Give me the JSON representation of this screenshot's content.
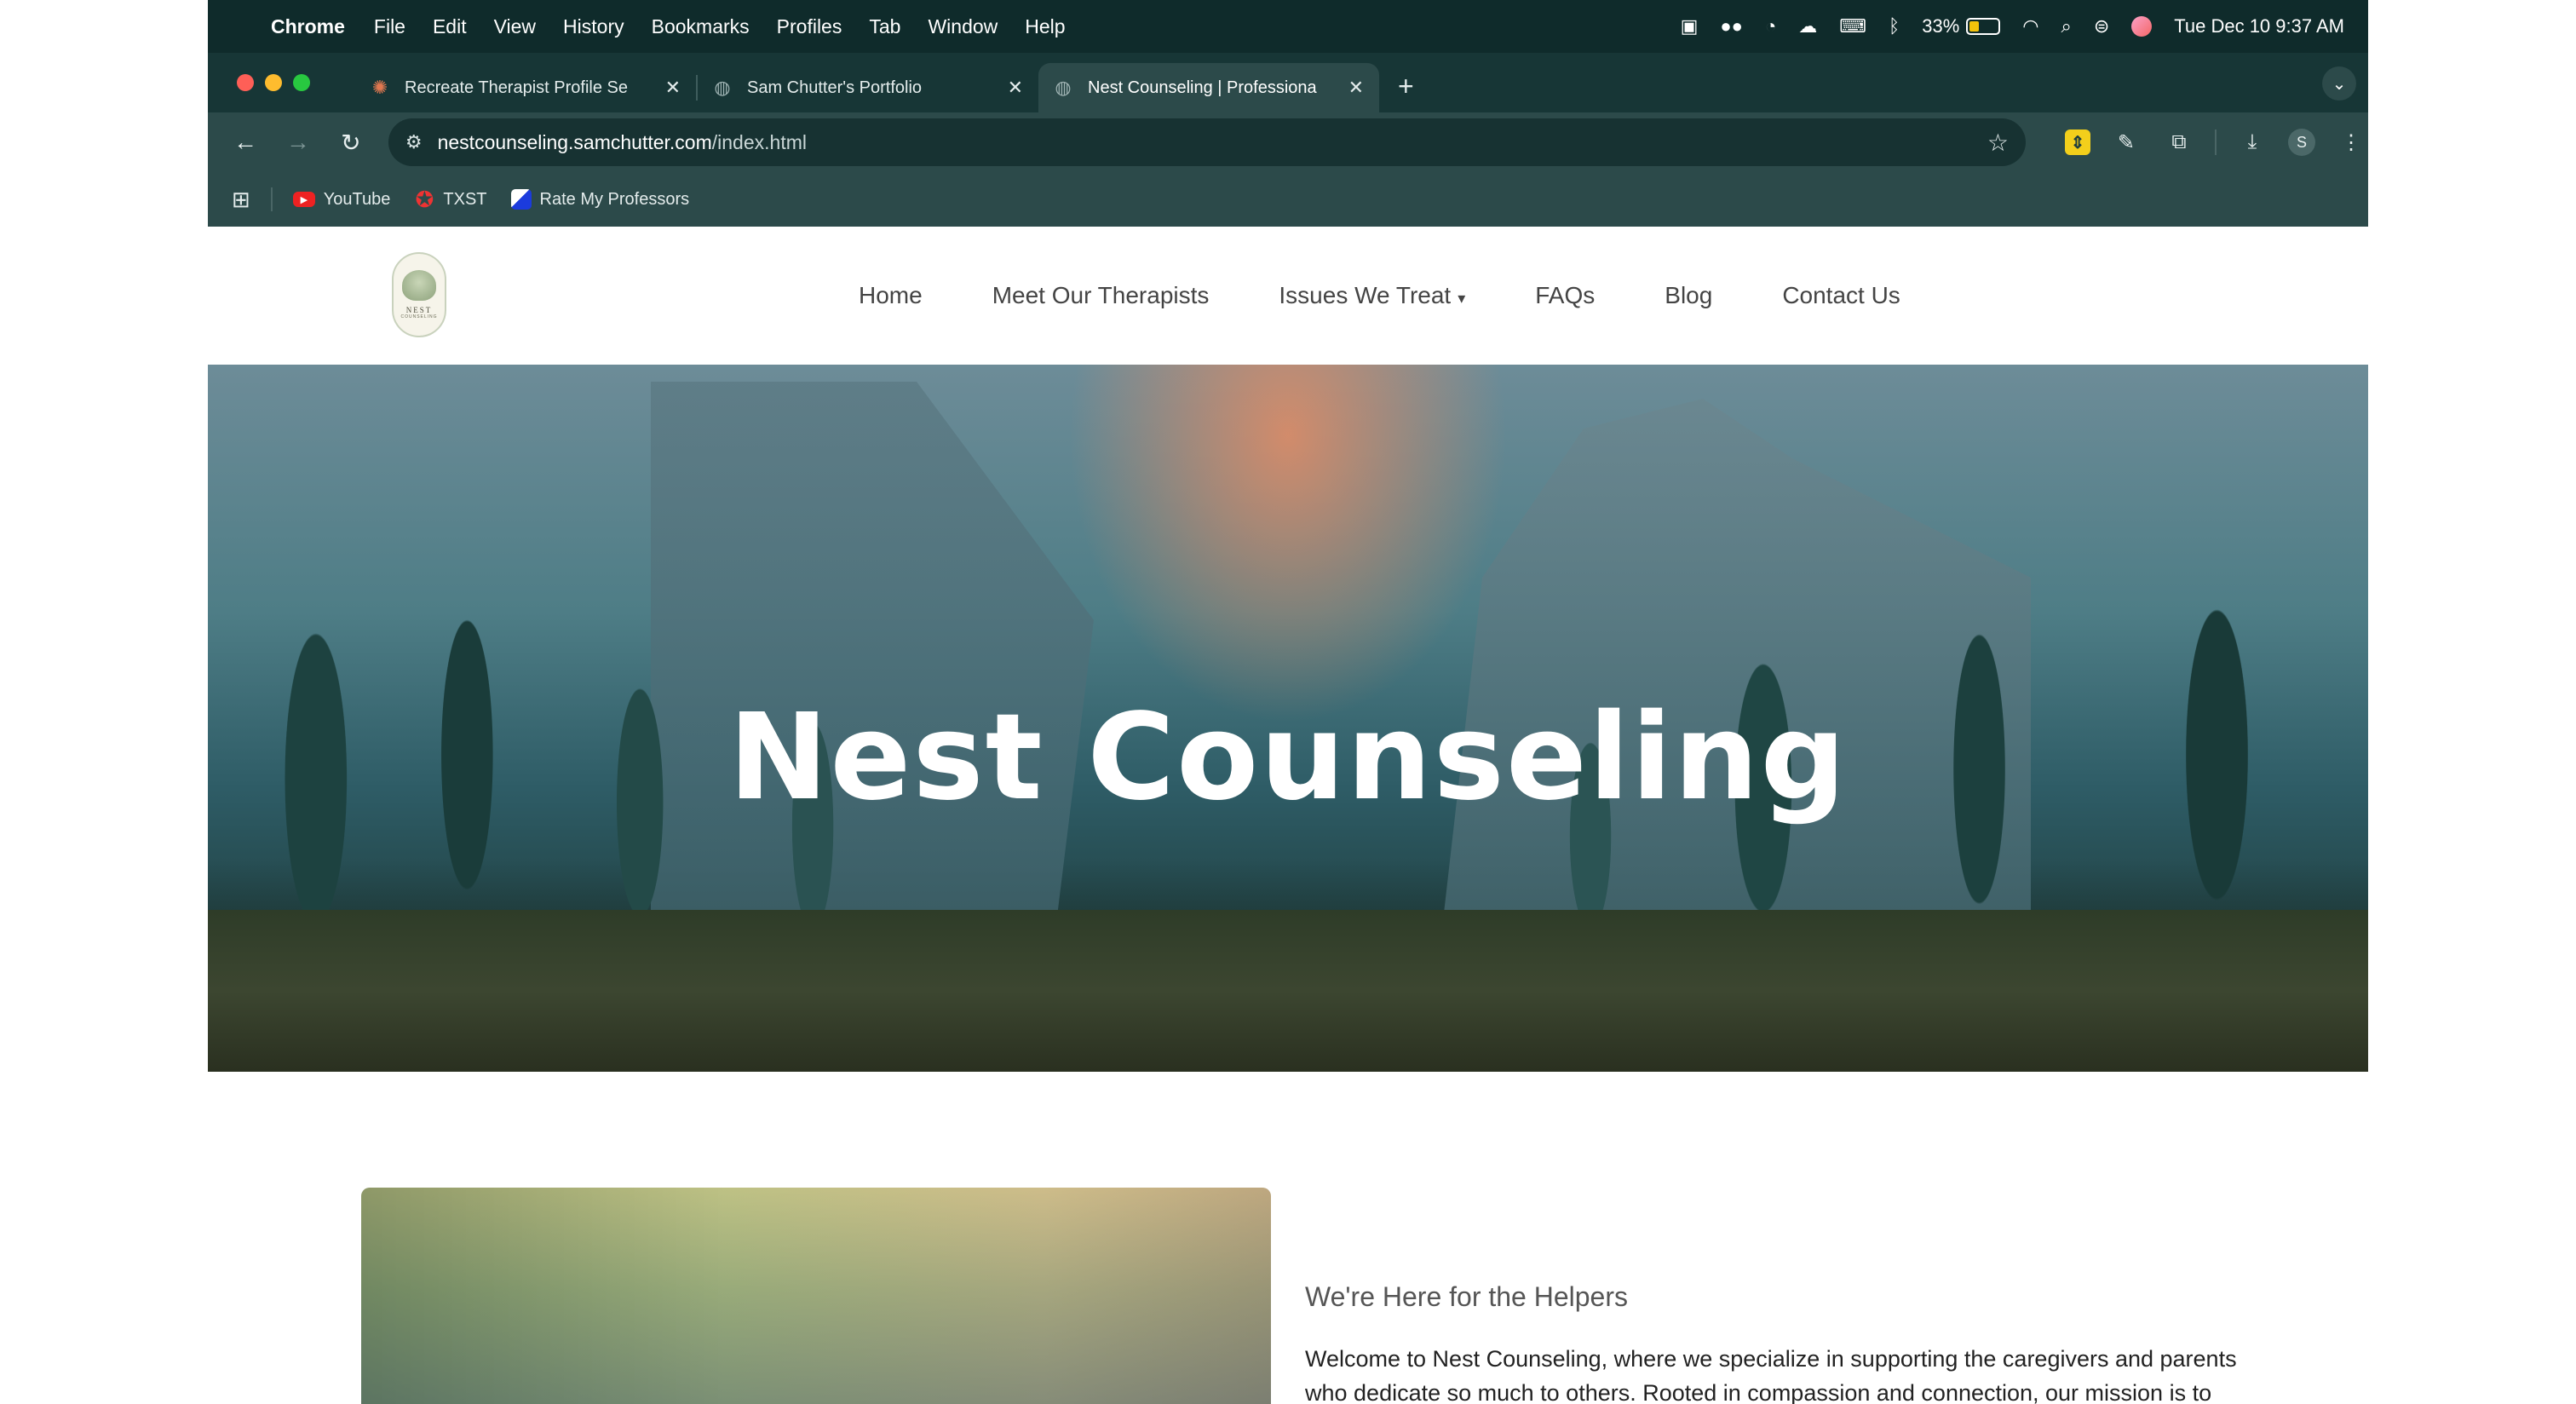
{
  "menubar": {
    "app": "Chrome",
    "items": [
      "File",
      "Edit",
      "View",
      "History",
      "Bookmarks",
      "Profiles",
      "Tab",
      "Window",
      "Help"
    ],
    "battery_percent": "33%",
    "battery_level": 0.33,
    "datetime": "Tue Dec 10  9:37 AM"
  },
  "tabs": [
    {
      "title": "Recreate Therapist Profile Se",
      "icon": "claude-starburst-icon",
      "active": false
    },
    {
      "title": "Sam Chutter's Portfolio",
      "icon": "globe-icon",
      "active": false
    },
    {
      "title": "Nest Counseling | Professiona",
      "icon": "globe-icon",
      "active": true
    }
  ],
  "omnibox": {
    "host": "nestcounseling.samchutter.com",
    "path": "/index.html"
  },
  "bookmarks": [
    {
      "label": "YouTube",
      "icon": "youtube-icon"
    },
    {
      "label": "TXST",
      "icon": "txst-icon"
    },
    {
      "label": "Rate My Professors",
      "icon": "rmp-icon"
    }
  ],
  "profile_initial": "S",
  "site": {
    "logo_text": "NEST",
    "logo_subtext": "COUNSELING",
    "nav": [
      "Home",
      "Meet Our Therapists",
      "Issues We Treat",
      "FAQs",
      "Blog",
      "Contact Us"
    ],
    "hero_title": "Nest Counseling",
    "intro_heading": "We're Here for the Helpers",
    "intro_paragraph": "Welcome to Nest Counseling, where we specialize in supporting the caregivers and parents who dedicate so much to others. Rooted in compassion and connection, our mission is to help you find balance, healing, and strength in your own journey. Based in"
  }
}
